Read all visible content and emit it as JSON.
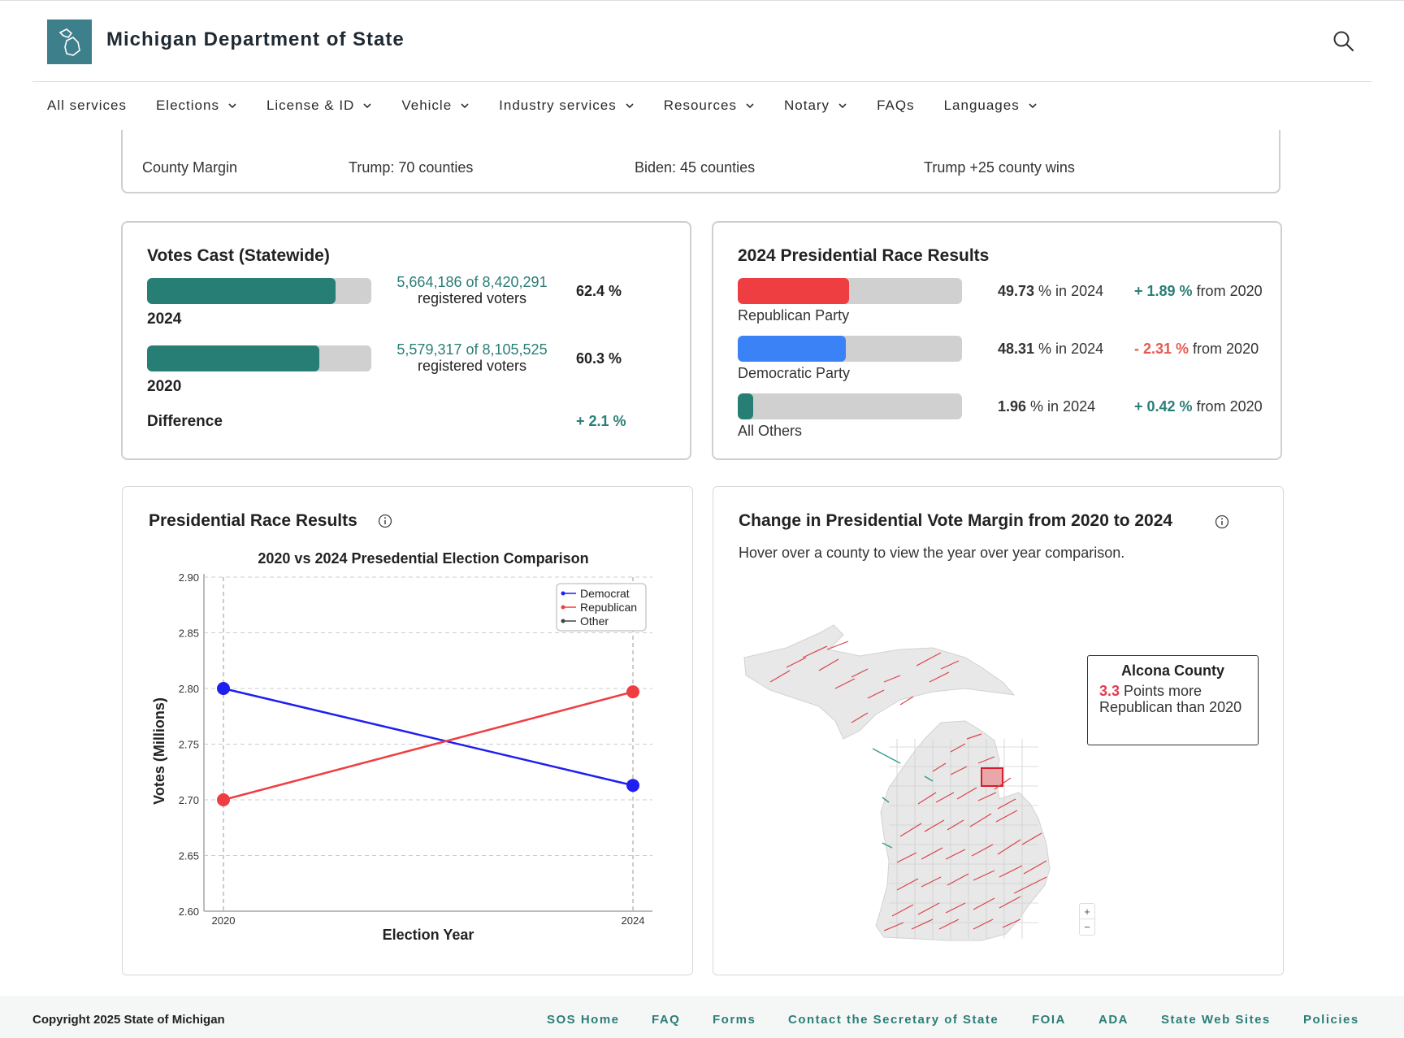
{
  "header": {
    "site_title": "Michigan Department of State",
    "logo_icon": "michigan-state-icon",
    "search_icon": "search-icon"
  },
  "nav": {
    "items": [
      {
        "label": "All services",
        "dropdown": false
      },
      {
        "label": "Elections",
        "dropdown": true
      },
      {
        "label": "License & ID",
        "dropdown": true
      },
      {
        "label": "Vehicle",
        "dropdown": true
      },
      {
        "label": "Industry services",
        "dropdown": true
      },
      {
        "label": "Resources",
        "dropdown": true
      },
      {
        "label": "Notary",
        "dropdown": true
      },
      {
        "label": "FAQs",
        "dropdown": false
      },
      {
        "label": "Languages",
        "dropdown": true
      }
    ]
  },
  "county_margin": {
    "label": "County Margin",
    "trump": "Trump: 70 counties",
    "biden": "Biden: 45 counties",
    "summary": "Trump +25 county wins"
  },
  "votes_cast": {
    "title": "Votes Cast (Statewide)",
    "rows": [
      {
        "year": "2024",
        "counts": "5,664,186 of 8,420,291",
        "sub": "registered voters",
        "pct": "62.4 %",
        "fill": 0.842
      },
      {
        "year": "2020",
        "counts": "5,579,317 of 8,105,525",
        "sub": "registered voters",
        "pct": "60.3 %",
        "fill": 0.768
      }
    ],
    "difference_label": "Difference",
    "difference_value": "+ 2.1 %",
    "bar_color": "#267e74"
  },
  "race_results": {
    "title": "2024 Presidential Race Results",
    "rows": [
      {
        "party": "Republican Party",
        "pct": "49.73",
        "pct_suffix": " % in 2024",
        "change_sign": "+ ",
        "change": "1.89 %",
        "change_suffix": " from 2020",
        "fill": 0.4973,
        "color": "#ef3e42",
        "change_color": "#2a7e77"
      },
      {
        "party": "Democratic Party",
        "pct": "48.31",
        "pct_suffix": " % in 2024",
        "change_sign": "- ",
        "change": "2.31 %",
        "change_suffix": " from 2020",
        "fill": 0.4831,
        "color": "#3b82f6",
        "change_color": "#e8584f"
      },
      {
        "party": "All Others",
        "pct": "1.96",
        "pct_suffix": " % in 2024",
        "change_sign": "+ ",
        "change": "0.42 %",
        "change_suffix": " from 2020",
        "fill": 0.0196,
        "color": "#267e74",
        "change_color": "#2a7e77"
      }
    ]
  },
  "race_chart_card": {
    "title": "Presidential Race Results",
    "info_icon": "info-icon"
  },
  "chart_data": {
    "type": "line",
    "title": "2020 vs 2024 Presedential Election Comparison",
    "xlabel": "Election Year",
    "ylabel": "Votes (Millions)",
    "x": [
      "2020",
      "2024"
    ],
    "ylim": [
      2.6,
      2.9
    ],
    "yticks": [
      "2.60",
      "2.65",
      "2.70",
      "2.75",
      "2.80",
      "2.85",
      "2.90"
    ],
    "grid": true,
    "legend_position": "top-right",
    "series": [
      {
        "name": "Democrat",
        "color": "#1f1ff0",
        "values": [
          2.8,
          2.713
        ]
      },
      {
        "name": "Republican",
        "color": "#ef3e42",
        "values": [
          2.7,
          2.797
        ]
      },
      {
        "name": "Other",
        "color": "#444444",
        "values": []
      }
    ]
  },
  "map_card": {
    "title": "Change in Presidential Vote Margin from 2020 to 2024",
    "info_icon": "info-icon",
    "subtitle": "Hover over a county to view the year over year comparison.",
    "tooltip_county": "Alcona County",
    "tooltip_points": "3.3",
    "tooltip_text": " Points more Republican than 2020",
    "zoom_in": "+",
    "zoom_out": "−",
    "arrow_color_rep": "#d9434a",
    "arrow_color_dem": "#3a9c8c"
  },
  "footer": {
    "copyright": "Copyright 2025 State of Michigan",
    "links": [
      "SOS Home",
      "FAQ",
      "Forms",
      "Contact the Secretary of State",
      "FOIA",
      "ADA",
      "State Web Sites",
      "Policies"
    ]
  }
}
